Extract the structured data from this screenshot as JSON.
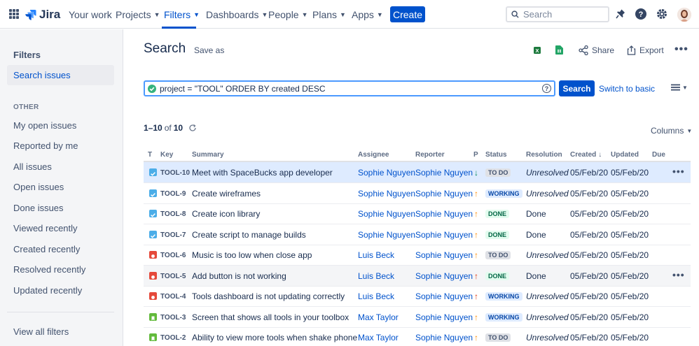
{
  "topnav": {
    "logo": "Jira",
    "items": [
      {
        "label": "Your work",
        "chevron": false
      },
      {
        "label": "Projects",
        "chevron": true
      },
      {
        "label": "Filters",
        "chevron": true,
        "active": true
      },
      {
        "label": "Dashboards",
        "chevron": true
      },
      {
        "label": "People",
        "chevron": true
      },
      {
        "label": "Plans",
        "chevron": true
      },
      {
        "label": "Apps",
        "chevron": true
      }
    ],
    "create_label": "Create",
    "search_placeholder": "Search",
    "icons": [
      "notifications-icon",
      "help-icon",
      "settings-icon",
      "profile-avatar"
    ]
  },
  "sidebar": {
    "title": "Filters",
    "search_issues": "Search issues",
    "section_label": "OTHER",
    "items": [
      "My open issues",
      "Reported by me",
      "All issues",
      "Open issues",
      "Done issues",
      "Viewed recently",
      "Created recently",
      "Resolved recently",
      "Updated recently"
    ],
    "view_all": "View all filters"
  },
  "header": {
    "title": "Search",
    "save_as": "Save as",
    "share": "Share",
    "export": "Export"
  },
  "jql": {
    "query": "project = \"TOOL\" ORDER BY created DESC",
    "search_button": "Search",
    "switch_label": "Switch to basic"
  },
  "results": {
    "range": "1–10",
    "of": "of",
    "total": "10",
    "columns_label": "Columns"
  },
  "table": {
    "headers": [
      "T",
      "Key",
      "Summary",
      "Assignee",
      "Reporter",
      "P",
      "Status",
      "Resolution",
      "Created",
      "Updated",
      "Due"
    ],
    "rows": [
      {
        "type": "task",
        "key": "TOOL-10",
        "summary": "Meet with SpaceBucks app developer",
        "assignee": "Sophie Nguyen",
        "reporter": "Sophie Nguyen",
        "priority": "low",
        "status": "TO DO",
        "resolution": "Unresolved",
        "created": "05/Feb/20",
        "updated": "05/Feb/20"
      },
      {
        "type": "task",
        "key": "TOOL-9",
        "summary": "Create wireframes",
        "assignee": "Sophie Nguyen",
        "reporter": "Sophie Nguyen",
        "priority": "medium",
        "status": "WORKING",
        "resolution": "Unresolved",
        "created": "05/Feb/20",
        "updated": "05/Feb/20"
      },
      {
        "type": "task",
        "key": "TOOL-8",
        "summary": "Create icon library",
        "assignee": "Sophie Nguyen",
        "reporter": "Sophie Nguyen",
        "priority": "medium",
        "status": "DONE",
        "resolution": "Done",
        "created": "05/Feb/20",
        "updated": "05/Feb/20"
      },
      {
        "type": "task",
        "key": "TOOL-7",
        "summary": "Create script to manage builds",
        "assignee": "Sophie Nguyen",
        "reporter": "Sophie Nguyen",
        "priority": "medium",
        "status": "DONE",
        "resolution": "Done",
        "created": "05/Feb/20",
        "updated": "05/Feb/20"
      },
      {
        "type": "bug",
        "key": "TOOL-6",
        "summary": "Music is too low when close app",
        "assignee": "Luis Beck",
        "reporter": "Sophie Nguyen",
        "priority": "medium",
        "status": "TO DO",
        "resolution": "Unresolved",
        "created": "05/Feb/20",
        "updated": "05/Feb/20"
      },
      {
        "type": "bug",
        "key": "TOOL-5",
        "summary": "Add button is not working",
        "assignee": "Luis Beck",
        "reporter": "Sophie Nguyen",
        "priority": "high",
        "status": "DONE",
        "resolution": "Done",
        "created": "05/Feb/20",
        "updated": "05/Feb/20"
      },
      {
        "type": "bug",
        "key": "TOOL-4",
        "summary": "Tools dashboard is not updating correctly",
        "assignee": "Luis Beck",
        "reporter": "Sophie Nguyen",
        "priority": "high",
        "status": "WORKING",
        "resolution": "Unresolved",
        "created": "05/Feb/20",
        "updated": "05/Feb/20"
      },
      {
        "type": "story",
        "key": "TOOL-3",
        "summary": "Screen that shows all tools in your toolbox",
        "assignee": "Max Taylor",
        "reporter": "Sophie Nguyen",
        "priority": "medium",
        "status": "WORKING",
        "resolution": "Unresolved",
        "created": "05/Feb/20",
        "updated": "05/Feb/20"
      },
      {
        "type": "story",
        "key": "TOOL-2",
        "summary": "Ability to view more tools when shake phone",
        "assignee": "Max Taylor",
        "reporter": "Sophie Nguyen",
        "priority": "medium",
        "status": "TO DO",
        "resolution": "Unresolved",
        "created": "05/Feb/20",
        "updated": "05/Feb/20"
      }
    ]
  },
  "colors": {
    "brand": "#0052CC",
    "priority_high": "#DE350B",
    "priority_medium": "#FF8B00",
    "priority_low": "#00875A"
  }
}
